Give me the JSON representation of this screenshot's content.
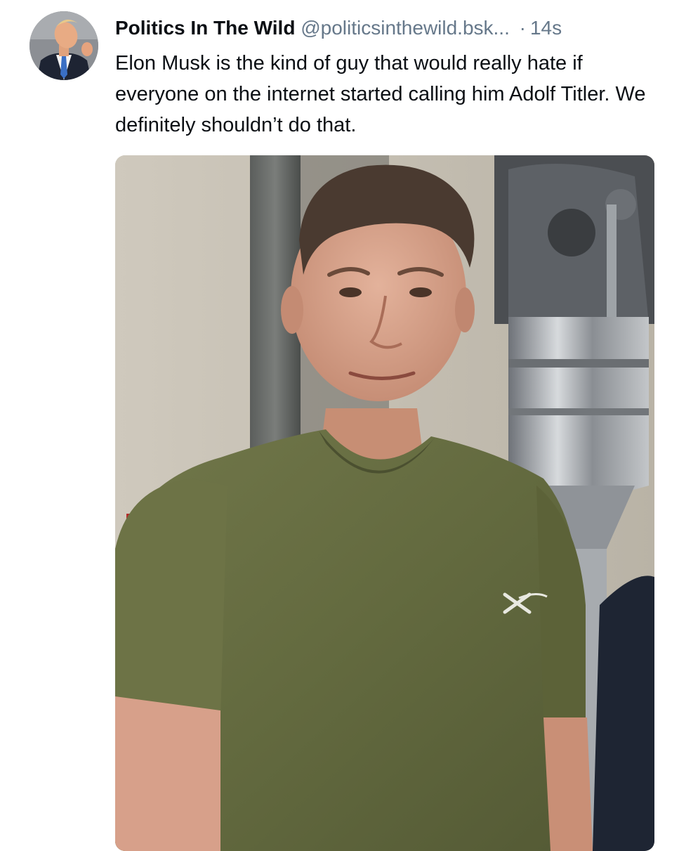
{
  "post": {
    "author": {
      "name": "Politics In The Wild",
      "handle": "@politicsinthewild.bsk...",
      "avatar_icon": "avatar-photo"
    },
    "separator": "·",
    "timestamp": "14s",
    "text": "Elon Musk is the kind of guy that would really hate if everyone on the internet started calling him Adolf Titler. We definitely shouldn’t do that.",
    "media": {
      "kind": "photo",
      "icon": "embedded-photo"
    }
  },
  "colors": {
    "text_primary": "#0b0f14",
    "text_secondary": "#66788a",
    "background": "#ffffff"
  }
}
